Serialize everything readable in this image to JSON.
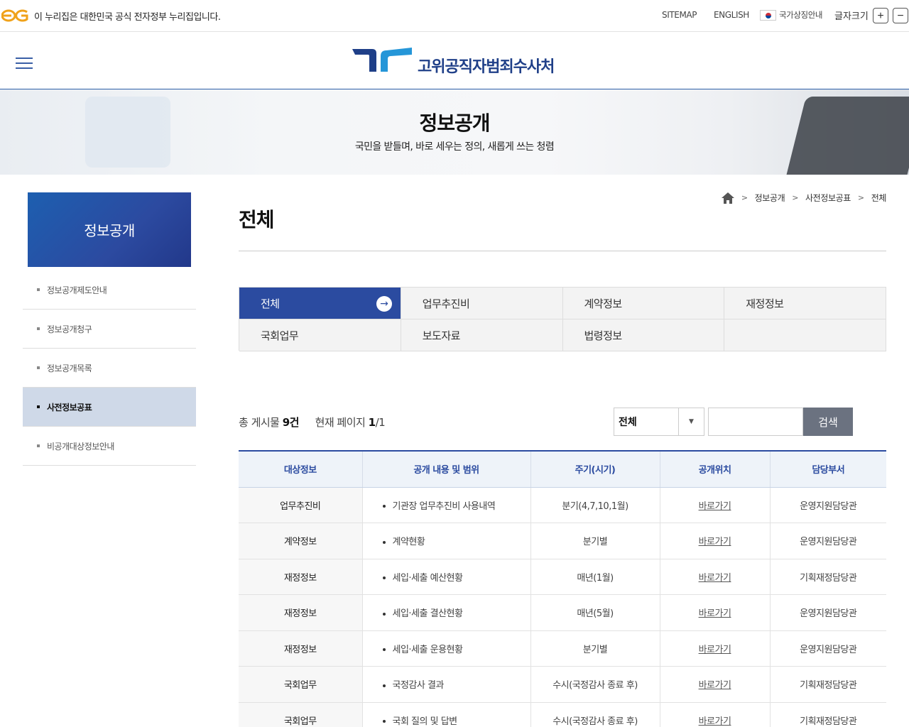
{
  "topbar": {
    "notice": "이 누리집은 대한민국 공식 전자정부 누리집입니다.",
    "sitemap": "SITEMAP",
    "english": "ENGLISH",
    "national_symbol": "국가상징안내",
    "font_size_label": "글자크기",
    "font_plus": "+",
    "font_minus": "−"
  },
  "header": {
    "org_name": "고위공직자범죄수사처"
  },
  "banner": {
    "title": "정보공개",
    "subtitle": "국민을 받들며, 바로 세우는 정의, 새롭게 쓰는 청렴"
  },
  "sidebar": {
    "title": "정보공개",
    "items": [
      {
        "label": "정보공개제도안내"
      },
      {
        "label": "정보공개청구"
      },
      {
        "label": "정보공개목록"
      },
      {
        "label": "사전정보공표"
      },
      {
        "label": "비공개대상정보안내"
      }
    ]
  },
  "breadcrumb": {
    "items": [
      "정보공개",
      "사전정보공표",
      "전체"
    ]
  },
  "page_title": "전체",
  "tabs": [
    {
      "label": "전체"
    },
    {
      "label": "업무추진비"
    },
    {
      "label": "계약정보"
    },
    {
      "label": "재정정보"
    },
    {
      "label": "국회업무"
    },
    {
      "label": "보도자료"
    },
    {
      "label": "법령정보"
    },
    {
      "label": ""
    }
  ],
  "summary": {
    "total_label": "총 게시물",
    "total_value": "9건",
    "page_label": "현재 페이지",
    "page_current": "1",
    "page_total": "/1"
  },
  "search": {
    "select_value": "전체",
    "input_value": "",
    "button_label": "검색"
  },
  "table": {
    "headers": [
      "대상정보",
      "공개 내용 및 범위",
      "주기(시기)",
      "공개위치",
      "담당부서"
    ],
    "rows": [
      {
        "category": "업무추진비",
        "content": "기관장 업무추진비 사용내역",
        "period": "분기(4,7,10,1월)",
        "link": "바로가기",
        "dept": "운영지원담당관"
      },
      {
        "category": "계약정보",
        "content": "계약현황",
        "period": "분기별",
        "link": "바로가기",
        "dept": "운영지원담당관"
      },
      {
        "category": "재정정보",
        "content": "세입·세출 예산현황",
        "period": "매년(1월)",
        "link": "바로가기",
        "dept": "기획재정담당관"
      },
      {
        "category": "재정정보",
        "content": "세입·세출 결산현황",
        "period": "매년(5월)",
        "link": "바로가기",
        "dept": "운영지원담당관"
      },
      {
        "category": "재정정보",
        "content": "세입·세출 운용현황",
        "period": "분기별",
        "link": "바로가기",
        "dept": "운영지원담당관"
      },
      {
        "category": "국회업무",
        "content": "국정감사 결과",
        "period": "수시(국정감사 종료 후)",
        "link": "바로가기",
        "dept": "기획재정담당관"
      },
      {
        "category": "국회업무",
        "content": "국회 질의 및 답변",
        "period": "수시(국정감사 종료 후)",
        "link": "바로가기",
        "dept": "기획재정담당관"
      }
    ]
  },
  "colors": {
    "primary": "#2b4ba0",
    "active_side": "#cfd9e8",
    "search_button": "#6b7280"
  }
}
